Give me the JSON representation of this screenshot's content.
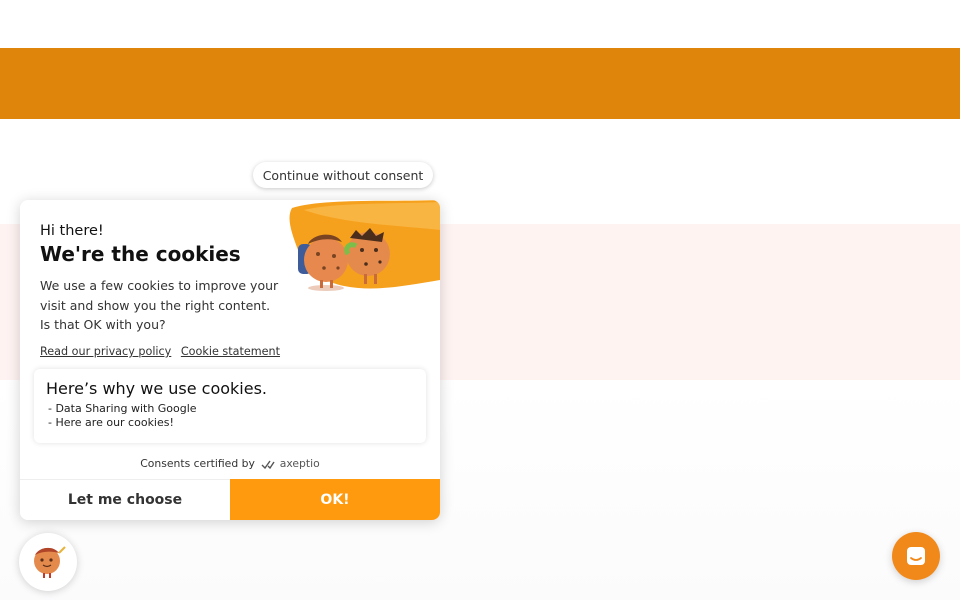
{
  "colors": {
    "brand_orange": "#e0850c",
    "button_orange": "#ff9a0f",
    "chat_orange": "#f1891a",
    "pink_band": "#fff3f2"
  },
  "consent": {
    "continue_without": "Continue without consent",
    "greeting": "Hi there!",
    "title": "We're the cookies",
    "body": [
      "We use a few cookies to improve your",
      "visit and show you the right content.",
      "Is that OK with you?"
    ],
    "links": {
      "privacy": "Read our privacy policy",
      "statement": "Cookie statement"
    },
    "why": {
      "title": "Here’s why we use cookies.",
      "items": [
        "- Data Sharing with Google",
        "- Here are our cookies!"
      ]
    },
    "certified_prefix": "Consents certified by",
    "certified_brand": "axeptio",
    "choose_label": "Let me choose",
    "ok_label": "OK!"
  },
  "icons": {
    "cookie_fab": "cookie-character-icon",
    "chat_fab": "chat-icon",
    "brand_logo": "axeptio-logo-icon"
  }
}
